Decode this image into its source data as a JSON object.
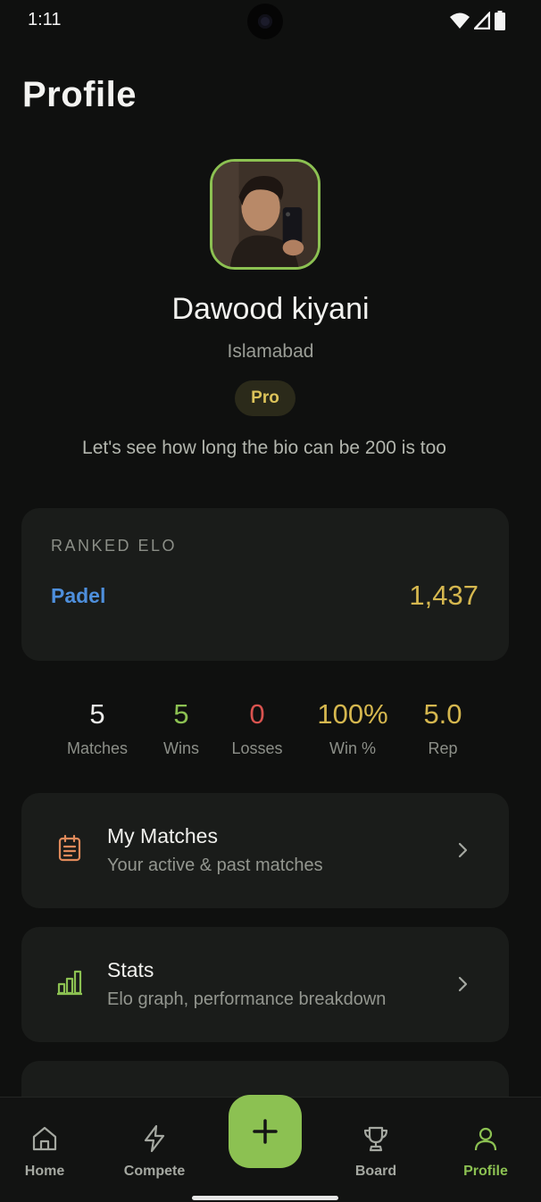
{
  "status_bar": {
    "time": "1:11"
  },
  "page": {
    "title": "Profile"
  },
  "user": {
    "name": "Dawood kiyani",
    "city": "Islamabad",
    "tier": "Pro",
    "bio": "Let's see how long the bio can be 200 is too"
  },
  "elo": {
    "heading": "RANKED ELO",
    "sport": "Padel",
    "value": "1,437"
  },
  "stats": [
    {
      "value": "5",
      "label": "Matches",
      "color": "#ececea"
    },
    {
      "value": "5",
      "label": "Wins",
      "color": "#8cc152"
    },
    {
      "value": "0",
      "label": "Losses",
      "color": "#d9534f"
    },
    {
      "value": "100%",
      "label": "Win %",
      "color": "#d5b74f"
    },
    {
      "value": "5.0",
      "label": "Rep",
      "color": "#d5b74f"
    }
  ],
  "menu": [
    {
      "title": "My Matches",
      "subtitle": "Your active & past matches",
      "icon": "clipboard-icon",
      "icon_color": "#e08a5b"
    },
    {
      "title": "Stats",
      "subtitle": "Elo graph, performance breakdown",
      "icon": "bar-chart-icon",
      "icon_color": "#8cc152"
    }
  ],
  "nav": [
    {
      "label": "Home",
      "icon": "home-icon"
    },
    {
      "label": "Compete",
      "icon": "lightning-icon"
    },
    {
      "label": "Board",
      "icon": "trophy-icon"
    },
    {
      "label": "Profile",
      "icon": "person-icon",
      "active": true
    }
  ],
  "colors": {
    "accent": "#8cc152",
    "gold": "#d5b74f",
    "blue": "#4e8fdc",
    "background": "#0f100f",
    "card": "#1a1c1a"
  }
}
